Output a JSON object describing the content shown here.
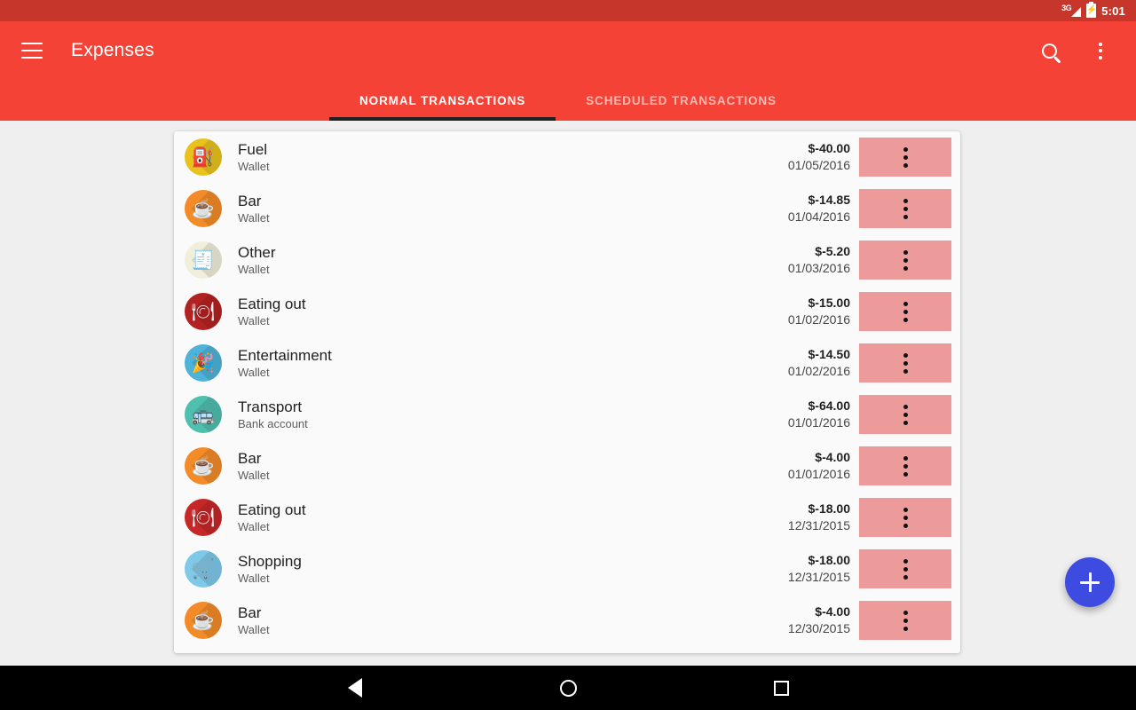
{
  "status_bar": {
    "network_label": "3G",
    "signal_icon": "signal-bars-icon",
    "battery_icon": "battery-charging-icon",
    "battery_glyph": "⚡",
    "time": "5:01"
  },
  "app_bar": {
    "menu_icon": "hamburger-menu-icon",
    "title": "Expenses",
    "search_icon": "search-icon",
    "overflow_icon": "overflow-menu-icon"
  },
  "tabs": [
    {
      "label": "NORMAL TRANSACTIONS",
      "active": true
    },
    {
      "label": "SCHEDULED TRANSACTIONS",
      "active": false
    }
  ],
  "colors": {
    "status_bar": "#C7362B",
    "app_bar": "#F44336",
    "tab_indicator": "#212121",
    "page_background": "#EFEFEF",
    "card_background": "#FAFAFA",
    "row_menu_button": "#ED9A9A",
    "fab": "#3D4BE0",
    "nav_bar": "#000000"
  },
  "transactions": [
    {
      "category": "Fuel",
      "account": "Wallet",
      "amount": "$-40.00",
      "date": "01/05/2016",
      "icon": "fuel-pump-icon",
      "glyph": "⛽",
      "bg": "#E8C31E",
      "fg": "#D94F3D",
      "menu_icon": "row-overflow-icon"
    },
    {
      "category": "Bar",
      "account": "Wallet",
      "amount": "$-14.85",
      "date": "01/04/2016",
      "icon": "coffee-cup-icon",
      "glyph": "☕",
      "bg": "#F28B28",
      "fg": "#37474F",
      "menu_icon": "row-overflow-icon"
    },
    {
      "category": "Other",
      "account": "Wallet",
      "amount": "$-5.20",
      "date": "01/03/2016",
      "icon": "receipt-icon",
      "glyph": "🧾",
      "bg": "#F2EEDC",
      "fg": "#E8707A",
      "menu_icon": "row-overflow-icon"
    },
    {
      "category": "Eating out",
      "account": "Wallet",
      "amount": "$-15.00",
      "date": "01/02/2016",
      "icon": "dinner-plate-icon",
      "glyph": "🍽",
      "bg": "#B32222",
      "fg": "#ECEFF1",
      "menu_icon": "row-overflow-icon"
    },
    {
      "category": "Entertainment",
      "account": "Wallet",
      "amount": "$-14.50",
      "date": "01/02/2016",
      "icon": "party-hat-icon",
      "glyph": "🎉",
      "bg": "#4FB3D9",
      "fg": "#FFFFFF",
      "menu_icon": "row-overflow-icon"
    },
    {
      "category": "Transport",
      "account": "Bank account",
      "amount": "$-64.00",
      "date": "01/01/2016",
      "icon": "bus-icon",
      "glyph": "🚌",
      "bg": "#4FBFAE",
      "fg": "#FFFFFF",
      "menu_icon": "row-overflow-icon"
    },
    {
      "category": "Bar",
      "account": "Wallet",
      "amount": "$-4.00",
      "date": "01/01/2016",
      "icon": "coffee-cup-icon",
      "glyph": "☕",
      "bg": "#F28B28",
      "fg": "#37474F",
      "menu_icon": "row-overflow-icon"
    },
    {
      "category": "Eating out",
      "account": "Wallet",
      "amount": "$-18.00",
      "date": "12/31/2015",
      "icon": "dinner-plate-icon",
      "glyph": "🍽",
      "bg": "#C62828",
      "fg": "#ECEFF1",
      "menu_icon": "row-overflow-icon"
    },
    {
      "category": "Shopping",
      "account": "Wallet",
      "amount": "$-18.00",
      "date": "12/31/2015",
      "icon": "shopping-cart-icon",
      "glyph": "🛒",
      "bg": "#7EC8E8",
      "fg": "#FFFFFF",
      "menu_icon": "row-overflow-icon"
    },
    {
      "category": "Bar",
      "account": "Wallet",
      "amount": "$-4.00",
      "date": "12/30/2015",
      "icon": "coffee-cup-icon",
      "glyph": "☕",
      "bg": "#F28B28",
      "fg": "#37474F",
      "menu_icon": "row-overflow-icon"
    }
  ],
  "fab": {
    "icon": "add-plus-icon",
    "label": "+"
  },
  "nav_bar": {
    "back_icon": "nav-back-icon",
    "home_icon": "nav-home-icon",
    "recents_icon": "nav-recents-icon"
  }
}
